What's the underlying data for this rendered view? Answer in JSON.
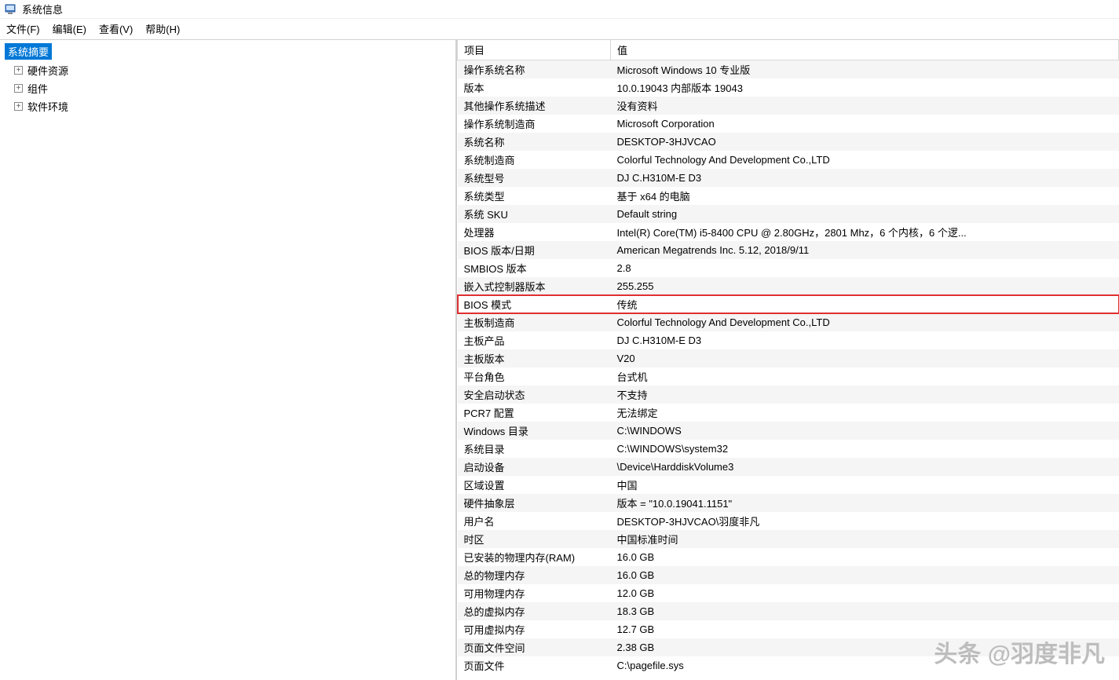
{
  "window": {
    "title": "系统信息"
  },
  "menu": {
    "file": "文件(F)",
    "edit": "编辑(E)",
    "view": "查看(V)",
    "help": "帮助(H)"
  },
  "tree": {
    "root": "系统摘要",
    "items": [
      "硬件资源",
      "组件",
      "软件环境"
    ]
  },
  "table": {
    "headers": {
      "item": "项目",
      "value": "值"
    },
    "rows": [
      {
        "item": "操作系统名称",
        "value": "Microsoft Windows 10 专业版",
        "hl": false
      },
      {
        "item": "版本",
        "value": "10.0.19043 内部版本 19043",
        "hl": false
      },
      {
        "item": "其他操作系统描述",
        "value": "没有资料",
        "hl": false
      },
      {
        "item": "操作系统制造商",
        "value": "Microsoft Corporation",
        "hl": false
      },
      {
        "item": "系统名称",
        "value": "DESKTOP-3HJVCAO",
        "hl": false
      },
      {
        "item": "系统制造商",
        "value": "Colorful Technology And Development Co.,LTD",
        "hl": false
      },
      {
        "item": "系统型号",
        "value": "DJ C.H310M-E D3",
        "hl": false
      },
      {
        "item": "系统类型",
        "value": "基于 x64 的电脑",
        "hl": false
      },
      {
        "item": "系统 SKU",
        "value": "Default string",
        "hl": false
      },
      {
        "item": "处理器",
        "value": "Intel(R) Core(TM) i5-8400 CPU @ 2.80GHz，2801 Mhz，6 个内核，6 个逻...",
        "hl": false
      },
      {
        "item": "BIOS 版本/日期",
        "value": "American Megatrends Inc. 5.12, 2018/9/11",
        "hl": false
      },
      {
        "item": "SMBIOS 版本",
        "value": "2.8",
        "hl": false
      },
      {
        "item": "嵌入式控制器版本",
        "value": "255.255",
        "hl": false
      },
      {
        "item": "BIOS 模式",
        "value": "传统",
        "hl": true
      },
      {
        "item": "主板制造商",
        "value": "Colorful Technology And Development Co.,LTD",
        "hl": false
      },
      {
        "item": "主板产品",
        "value": "DJ C.H310M-E D3",
        "hl": false
      },
      {
        "item": "主板版本",
        "value": "V20",
        "hl": false
      },
      {
        "item": "平台角色",
        "value": "台式机",
        "hl": false
      },
      {
        "item": "安全启动状态",
        "value": "不支持",
        "hl": false
      },
      {
        "item": "PCR7 配置",
        "value": "无法绑定",
        "hl": false
      },
      {
        "item": "Windows 目录",
        "value": "C:\\WINDOWS",
        "hl": false
      },
      {
        "item": "系统目录",
        "value": "C:\\WINDOWS\\system32",
        "hl": false
      },
      {
        "item": "启动设备",
        "value": "\\Device\\HarddiskVolume3",
        "hl": false
      },
      {
        "item": "区域设置",
        "value": "中国",
        "hl": false
      },
      {
        "item": "硬件抽象层",
        "value": "版本 = \"10.0.19041.1151\"",
        "hl": false
      },
      {
        "item": "用户名",
        "value": "DESKTOP-3HJVCAO\\羽度非凡",
        "hl": false
      },
      {
        "item": "时区",
        "value": "中国标准时间",
        "hl": false
      },
      {
        "item": "已安装的物理内存(RAM)",
        "value": "16.0 GB",
        "hl": false
      },
      {
        "item": "总的物理内存",
        "value": "16.0 GB",
        "hl": false
      },
      {
        "item": "可用物理内存",
        "value": "12.0 GB",
        "hl": false
      },
      {
        "item": "总的虚拟内存",
        "value": "18.3 GB",
        "hl": false
      },
      {
        "item": "可用虚拟内存",
        "value": "12.7 GB",
        "hl": false
      },
      {
        "item": "页面文件空间",
        "value": "2.38 GB",
        "hl": false
      },
      {
        "item": "页面文件",
        "value": "C:\\pagefile.sys",
        "hl": false
      }
    ]
  },
  "watermark": "头条 @羽度非凡"
}
